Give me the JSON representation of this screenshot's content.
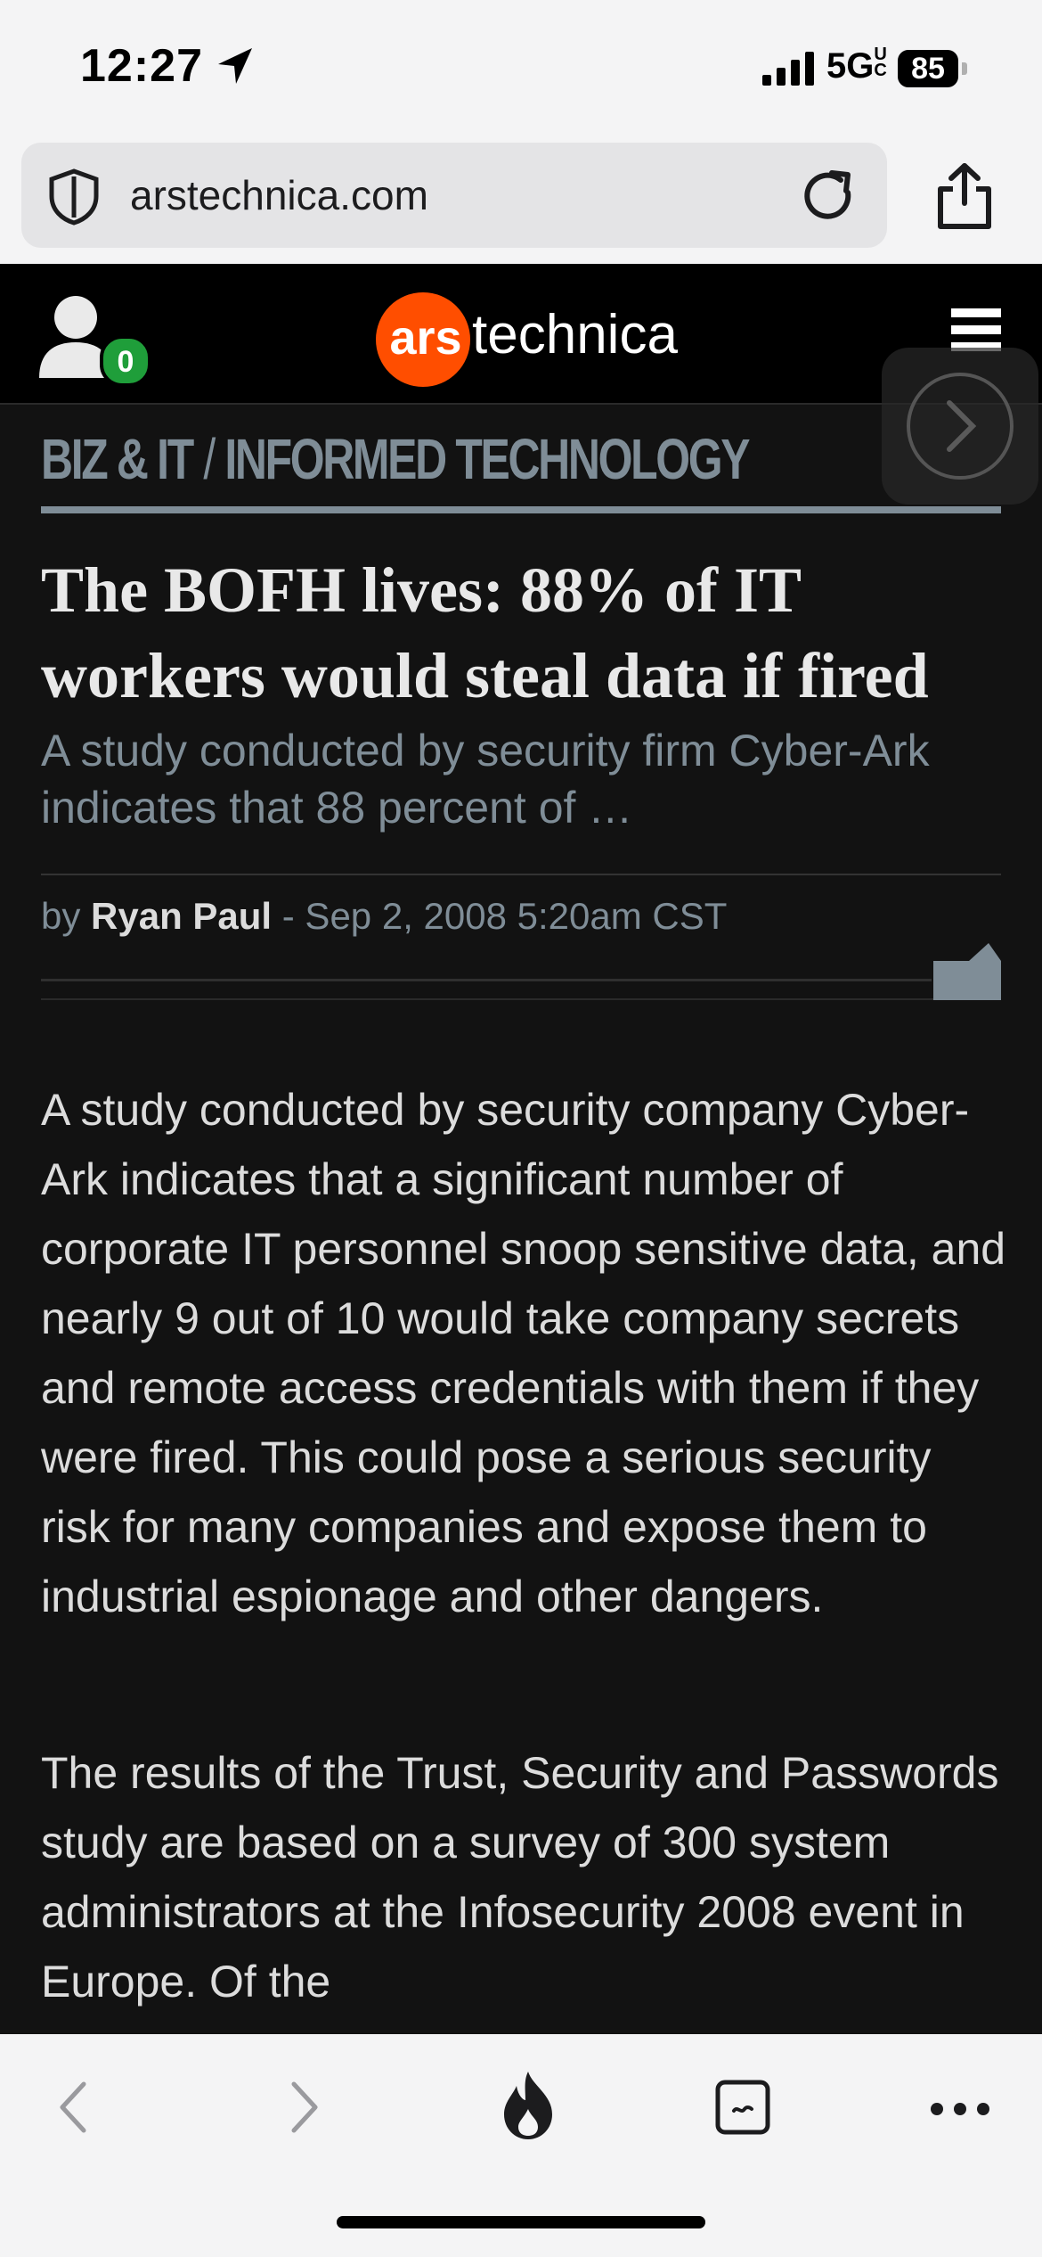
{
  "status_bar": {
    "time": "12:27",
    "network": "5G",
    "network_sup": "UC",
    "battery": "85"
  },
  "browser": {
    "url": "arstechnica.com"
  },
  "site": {
    "logo_ars": "ars",
    "logo_technica": "technica",
    "notification_count": "0"
  },
  "article": {
    "category_section": "BIZ & IT",
    "category_separator": "/",
    "category_sub": "INFORMED TECHNOLOGY",
    "title": "The BOFH lives: 88% of IT workers would steal data if fired",
    "subtitle": "A study conducted by security firm Cyber-Ark indicates that 88 percent of …",
    "byline_prefix": "by",
    "author": "Ryan Paul",
    "date": "- Sep 2, 2008 5:20am CST",
    "paragraphs": [
      "A study conducted by security company Cyber-Ark indicates that a significant number of corporate IT personnel snoop sensitive data, and nearly 9 out of 10 would take company secrets and remote access credentials with them if they were fired. This could pose a serious security risk for many companies and expose them to industrial espionage and other dangers.",
      "The results of the Trust, Security and Passwords study are based on a survey of 300 system administrators at the Infosecurity 2008 event in Europe. Of the"
    ]
  }
}
